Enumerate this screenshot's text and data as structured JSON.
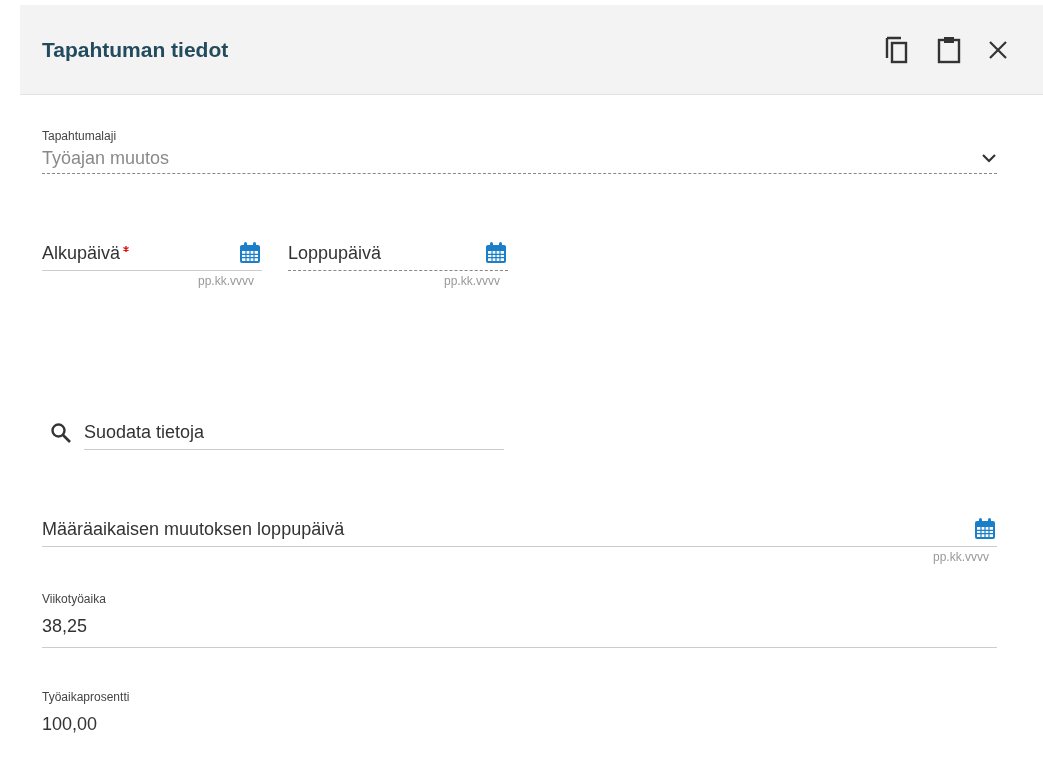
{
  "header": {
    "title": "Tapahtuman tiedot",
    "actions": [
      {
        "kind": "copy"
      },
      {
        "kind": "paste"
      },
      {
        "kind": "close"
      }
    ]
  },
  "event_type": {
    "label": "Tapahtumalaji",
    "value": "Työajan muutos",
    "disabled": true
  },
  "dates": [
    {
      "label": "Alkupäivä",
      "required": true,
      "disabled": false,
      "hint": "pp.kk.vvvv"
    },
    {
      "label": "Loppupäivä",
      "required": false,
      "disabled": true,
      "hint": "pp.kk.vvvv"
    }
  ],
  "filter": {
    "placeholder": "Suodata tietoja"
  },
  "end_date": {
    "label": "Määräaikaisen muutoksen loppupäivä",
    "required": false,
    "disabled": false,
    "hint": "pp.kk.vvvv"
  },
  "fields": [
    {
      "label": "Viikotyöaika",
      "value": "38,25"
    },
    {
      "label": "Työaikaprosentti",
      "value": "100,00"
    }
  ]
}
